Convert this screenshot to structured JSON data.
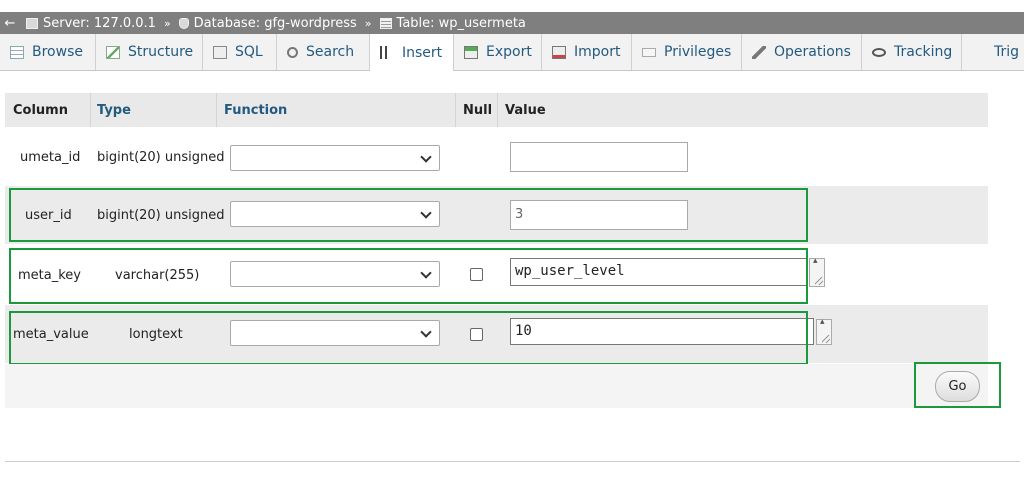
{
  "breadcrumb": {
    "back": "←",
    "server": "Server: 127.0.0.1",
    "database": "Database: gfg-wordpress",
    "table": "Table: wp_usermeta",
    "separator": "»"
  },
  "tabs": [
    {
      "label": "Browse",
      "icon": "browse-icon"
    },
    {
      "label": "Structure",
      "icon": "structure-icon"
    },
    {
      "label": "SQL",
      "icon": "sql-icon"
    },
    {
      "label": "Search",
      "icon": "search-icon"
    },
    {
      "label": "Insert",
      "icon": "insert-icon",
      "active": true
    },
    {
      "label": "Export",
      "icon": "export-icon"
    },
    {
      "label": "Import",
      "icon": "import-icon"
    },
    {
      "label": "Privileges",
      "icon": "privileges-icon"
    },
    {
      "label": "Operations",
      "icon": "operations-icon"
    },
    {
      "label": "Tracking",
      "icon": "tracking-icon"
    },
    {
      "label": "Trig",
      "icon": "triggers-icon"
    }
  ],
  "table": {
    "headers": {
      "column": "Column",
      "type": "Type",
      "function": "Function",
      "null": "Null",
      "value": "Value"
    },
    "rows": [
      {
        "column": "umeta_id",
        "type": "bigint(20) unsigned",
        "function": "",
        "value": ""
      },
      {
        "column": "user_id",
        "type": "bigint(20) unsigned",
        "function": "",
        "value": "3"
      },
      {
        "column": "meta_key",
        "type": "varchar(255)",
        "function": "",
        "null_checked": false,
        "value": "wp_user_level"
      },
      {
        "column": "meta_value",
        "type": "longtext",
        "function": "",
        "null_checked": false,
        "value": "10"
      }
    ]
  },
  "actions": {
    "go": "Go"
  },
  "colors": {
    "highlight": "#1a9a3a",
    "link": "#235a81",
    "breadcrumb_bg": "#7f7f7f"
  }
}
